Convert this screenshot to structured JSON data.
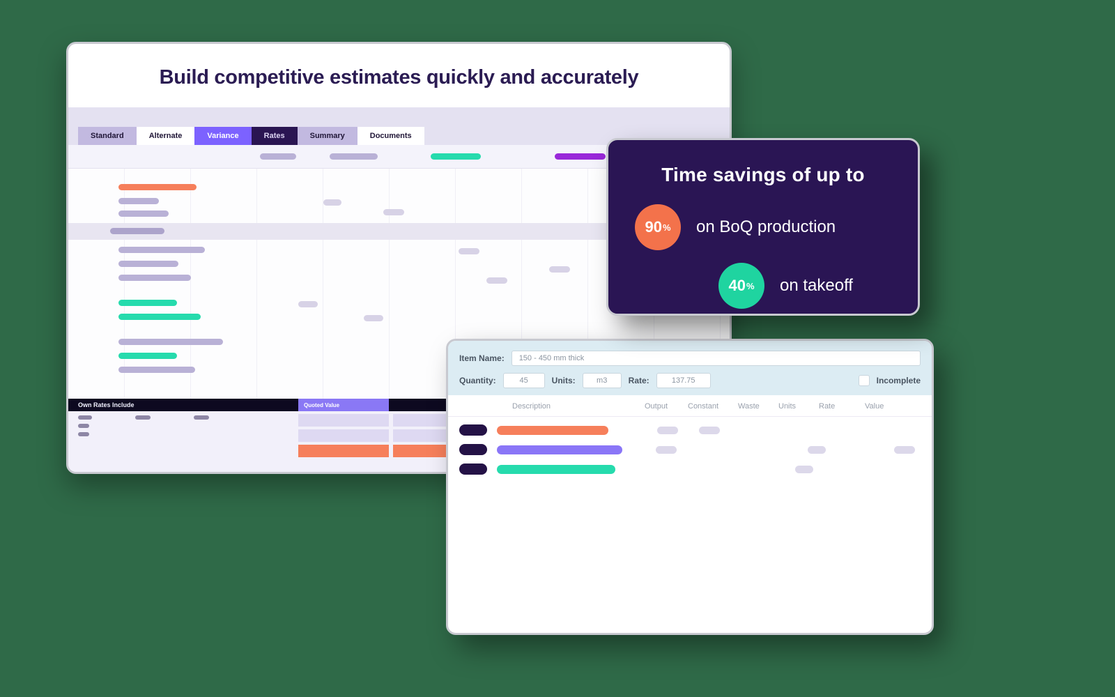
{
  "main": {
    "title": "Build competitive estimates quickly and accurately",
    "tabs": {
      "standard": "Standard",
      "alternate": "Alternate",
      "variance": "Variance",
      "rates": "Rates",
      "summary": "Summary",
      "documents": "Documents"
    },
    "footer": {
      "own_rates": "Own Rates Include",
      "quoted_value": "Quoted Value"
    }
  },
  "stat": {
    "title": "Time savings of up to",
    "v1": "90",
    "pct": "%",
    "l1": "on BoQ production",
    "v2": "40",
    "l2": "on takeoff"
  },
  "detail": {
    "item_name_lbl": "Item Name:",
    "item_name_val": "150 - 450 mm thick",
    "qty_lbl": "Quantity:",
    "qty_val": "45",
    "units_lbl": "Units:",
    "units_val": "m3",
    "rate_lbl": "Rate:",
    "rate_val": "137.75",
    "incomplete": "Incomplete",
    "cols": {
      "desc": "Description",
      "output": "Output",
      "constant": "Constant",
      "waste": "Waste",
      "units": "Units",
      "rate": "Rate",
      "value": "Value"
    }
  },
  "colors": {
    "orange": "#f67f5b",
    "violet": "#9f8df7",
    "teal": "#26dbad",
    "purple": "#9928d9",
    "lav": "#b9b1d6",
    "lav2": "#c9c3df"
  }
}
